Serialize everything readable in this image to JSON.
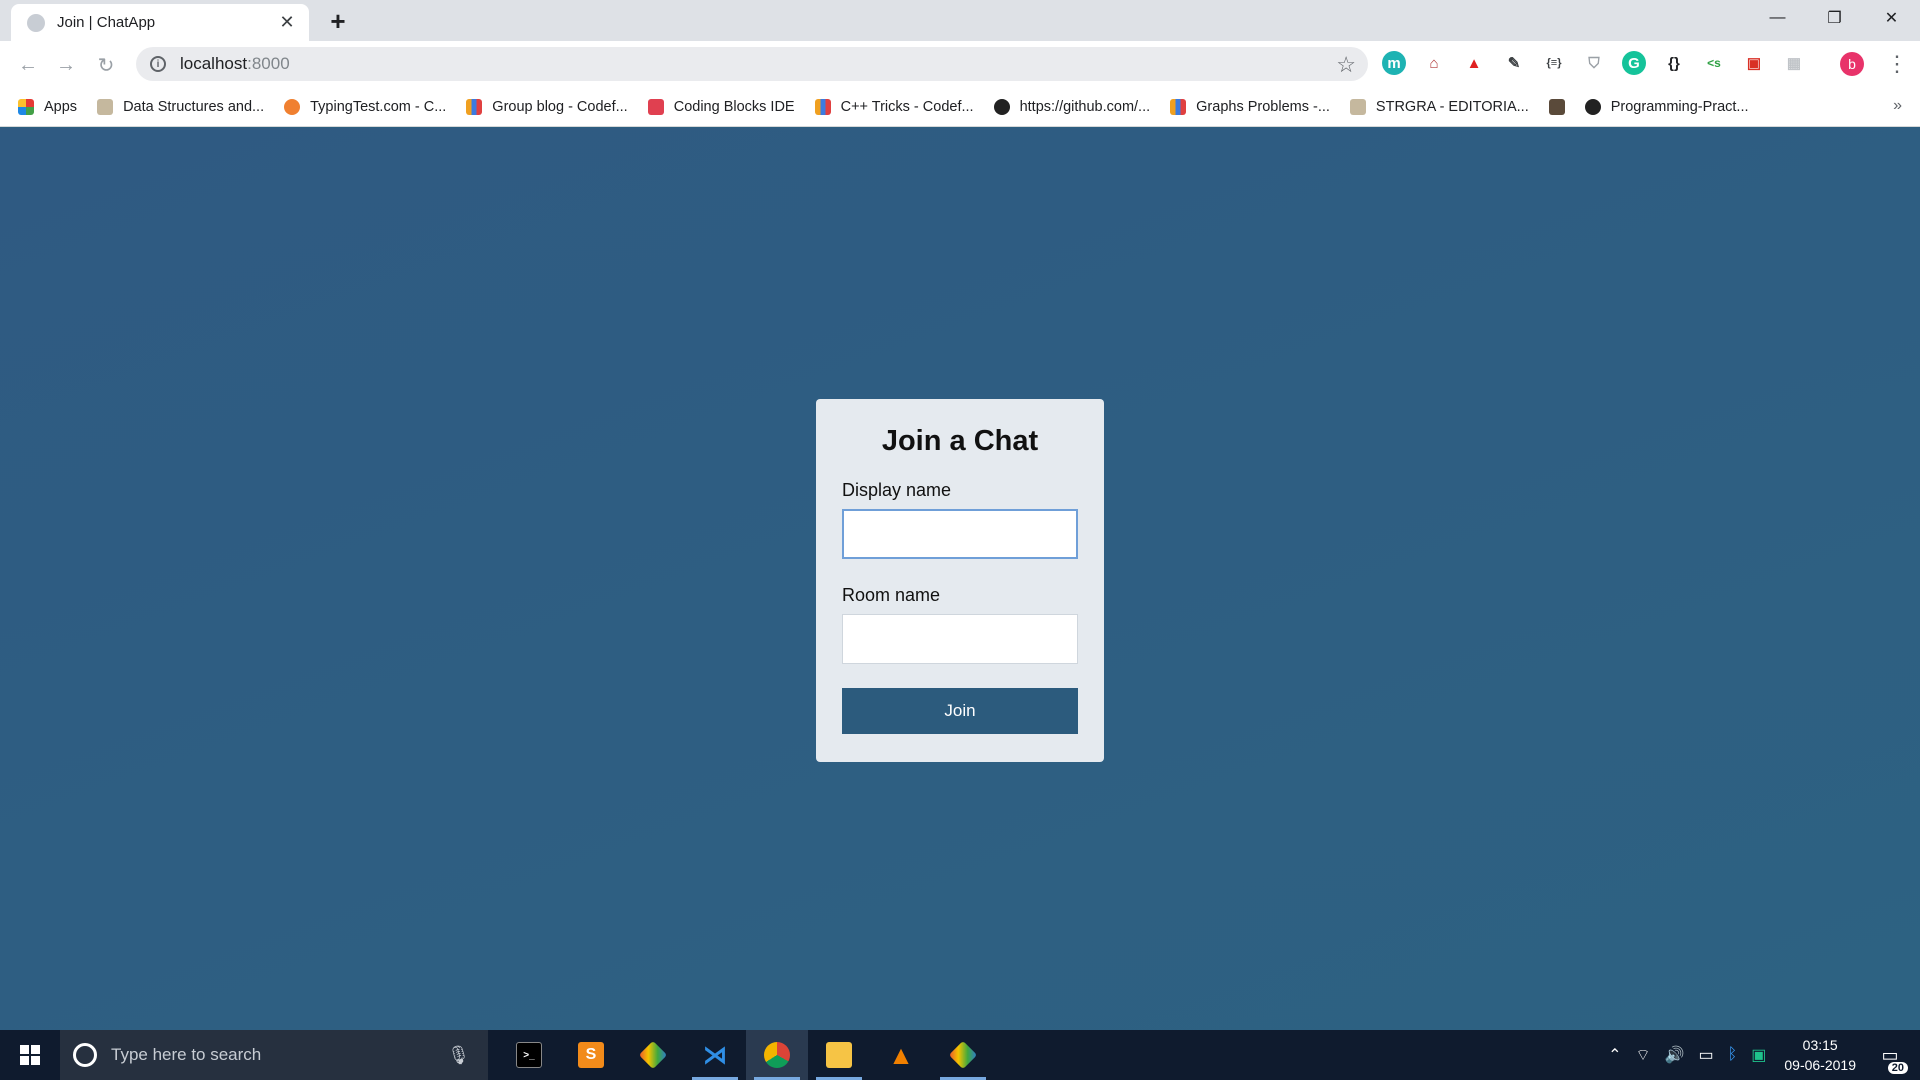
{
  "browser": {
    "tab_title": "Join | ChatApp",
    "url_host": "localhost",
    "url_port": ":8000",
    "bookmarks": [
      {
        "label": "Apps",
        "color": "#e53935"
      },
      {
        "label": "Data Structures and...",
        "color": "#c5b89e"
      },
      {
        "label": "TypingTest.com - C...",
        "color": "#f08030"
      },
      {
        "label": "Group blog - Codef...",
        "color": "#3b7be0"
      },
      {
        "label": "Coding Blocks IDE",
        "color": "#e04050"
      },
      {
        "label": "C++ Tricks - Codef...",
        "color": "#3b7be0"
      },
      {
        "label": "https://github.com/...",
        "color": "#222222"
      },
      {
        "label": "Graphs Problems -...",
        "color": "#3b7be0"
      },
      {
        "label": "STRGRA - EDITORIA...",
        "color": "#c5b89e"
      },
      {
        "label": "",
        "color": "#5a4a3a"
      },
      {
        "label": "Programming-Pract...",
        "color": "#222222"
      }
    ],
    "profile_initial": "b"
  },
  "page": {
    "card_title": "Join a Chat",
    "display_name_label": "Display name",
    "display_name_value": "",
    "room_name_label": "Room name",
    "room_name_value": "",
    "join_label": "Join"
  },
  "taskbar": {
    "search_placeholder": "Type here to search",
    "time": "03:15",
    "date": "09-06-2019",
    "notification_count": "20"
  }
}
